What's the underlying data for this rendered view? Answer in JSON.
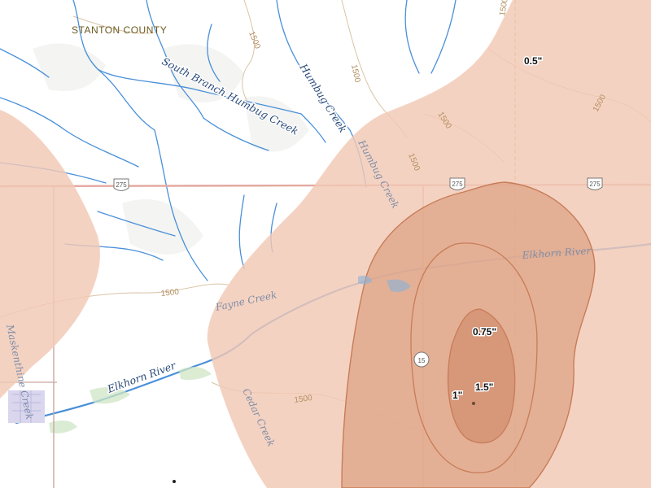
{
  "map": {
    "county_label": "STANTON COUNTY",
    "colors": {
      "land": "#ffffff",
      "water": "#4a90d9",
      "water_faint": "#9fb4cc",
      "road": "#e3a9a0",
      "contour": "#d4b895",
      "hail_light": "#f2c8b4",
      "hail_mid": "#dea284",
      "hail_dark": "#c97d5d",
      "hail_outline": "#c77c58"
    },
    "water_labels": [
      {
        "text": "South Branch Humbug Creek"
      },
      {
        "text": "Humbug Creek"
      },
      {
        "text": "Humbug Creek"
      },
      {
        "text": "Elkhorn River"
      },
      {
        "text": "Elkhorn River"
      },
      {
        "text": "Fayne Creek"
      },
      {
        "text": "Cedar Creek"
      },
      {
        "text": "Maskenthine Creek"
      }
    ],
    "contour_labels": [
      "1500",
      "1500",
      "1500",
      "1500",
      "1500",
      "1500",
      "1500",
      "1500"
    ],
    "route_shields": [
      {
        "text": "275",
        "type": "us-highway"
      },
      {
        "text": "275",
        "type": "us-highway"
      },
      {
        "text": "275",
        "type": "us-highway"
      },
      {
        "text": "15",
        "type": "state-highway"
      }
    ],
    "hail_contours": [
      {
        "label": "0.5\"",
        "value_in": 0.5
      },
      {
        "label": "0.75\"",
        "value_in": 0.75
      },
      {
        "label": "1\"",
        "value_in": 1.0
      },
      {
        "label": "1.5\"",
        "value_in": 1.5
      }
    ]
  }
}
